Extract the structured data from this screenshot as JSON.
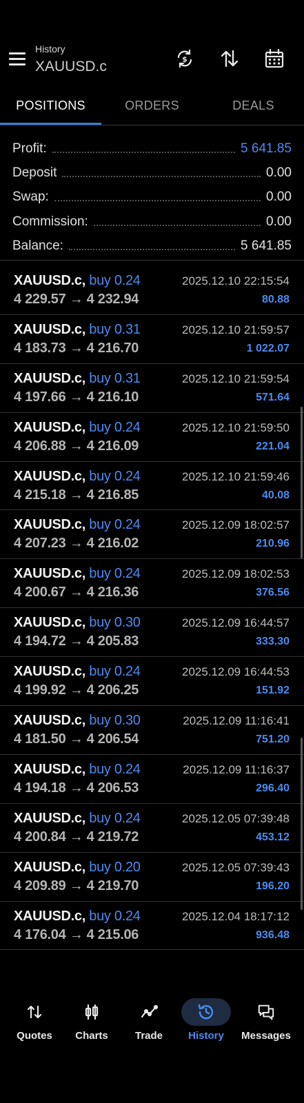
{
  "header": {
    "title": "History",
    "symbol": "XAUUSD.c",
    "icons": [
      "menu-icon",
      "currency-exchange-icon",
      "sort-icon",
      "calendar-icon"
    ]
  },
  "tabs": [
    {
      "label": "POSITIONS",
      "active": true
    },
    {
      "label": "ORDERS",
      "active": false
    },
    {
      "label": "DEALS",
      "active": false
    }
  ],
  "summary": {
    "profit_label": "Profit:",
    "profit_value": "5 641.85",
    "deposit_label": "Deposit",
    "deposit_value": "0.00",
    "swap_label": "Swap:",
    "swap_value": "0.00",
    "commission_label": "Commission:",
    "commission_value": "0.00",
    "balance_label": "Balance:",
    "balance_value": "5 641.85"
  },
  "deals": [
    {
      "symbol": "XAUUSD.c,",
      "dir": "buy 0.24",
      "prices": "4 229.57 → 4 232.94",
      "time": "2025.12.10 22:15:54",
      "profit": "80.88"
    },
    {
      "symbol": "XAUUSD.c,",
      "dir": "buy 0.31",
      "prices": "4 183.73 → 4 216.70",
      "time": "2025.12.10 21:59:57",
      "profit": "1 022.07"
    },
    {
      "symbol": "XAUUSD.c,",
      "dir": "buy 0.31",
      "prices": "4 197.66 → 4 216.10",
      "time": "2025.12.10 21:59:54",
      "profit": "571.64"
    },
    {
      "symbol": "XAUUSD.c,",
      "dir": "buy 0.24",
      "prices": "4 206.88 → 4 216.09",
      "time": "2025.12.10 21:59:50",
      "profit": "221.04"
    },
    {
      "symbol": "XAUUSD.c,",
      "dir": "buy 0.24",
      "prices": "4 215.18 → 4 216.85",
      "time": "2025.12.10 21:59:46",
      "profit": "40.08"
    },
    {
      "symbol": "XAUUSD.c,",
      "dir": "buy 0.24",
      "prices": "4 207.23 → 4 216.02",
      "time": "2025.12.09 18:02:57",
      "profit": "210.96"
    },
    {
      "symbol": "XAUUSD.c,",
      "dir": "buy 0.24",
      "prices": "4 200.67 → 4 216.36",
      "time": "2025.12.09 18:02:53",
      "profit": "376.56"
    },
    {
      "symbol": "XAUUSD.c,",
      "dir": "buy 0.30",
      "prices": "4 194.72 → 4 205.83",
      "time": "2025.12.09 16:44:57",
      "profit": "333.30"
    },
    {
      "symbol": "XAUUSD.c,",
      "dir": "buy 0.24",
      "prices": "4 199.92 → 4 206.25",
      "time": "2025.12.09 16:44:53",
      "profit": "151.92"
    },
    {
      "symbol": "XAUUSD.c,",
      "dir": "buy 0.30",
      "prices": "4 181.50 → 4 206.54",
      "time": "2025.12.09 11:16:41",
      "profit": "751.20"
    },
    {
      "symbol": "XAUUSD.c,",
      "dir": "buy 0.24",
      "prices": "4 194.18 → 4 206.53",
      "time": "2025.12.09 11:16:37",
      "profit": "296.40"
    },
    {
      "symbol": "XAUUSD.c,",
      "dir": "buy 0.24",
      "prices": "4 200.84 → 4 219.72",
      "time": "2025.12.05 07:39:48",
      "profit": "453.12"
    },
    {
      "symbol": "XAUUSD.c,",
      "dir": "buy 0.20",
      "prices": "4 209.89 → 4 219.70",
      "time": "2025.12.05 07:39:43",
      "profit": "196.20"
    },
    {
      "symbol": "XAUUSD.c,",
      "dir": "buy 0.24",
      "prices": "4 176.04 → 4 215.06",
      "time": "2025.12.04 18:17:12",
      "profit": "936.48"
    }
  ],
  "bottom_nav": [
    {
      "label": "Quotes",
      "icon": "quotes-arrows-icon",
      "active": false
    },
    {
      "label": "Charts",
      "icon": "candlestick-icon",
      "active": false
    },
    {
      "label": "Trade",
      "icon": "trade-line-icon",
      "active": false
    },
    {
      "label": "History",
      "icon": "history-icon",
      "active": true
    },
    {
      "label": "Messages",
      "icon": "messages-icon",
      "active": false
    }
  ],
  "colors": {
    "accent": "#4a8cf0",
    "background": "#000000",
    "tab_underline": "#3a7bd5"
  }
}
